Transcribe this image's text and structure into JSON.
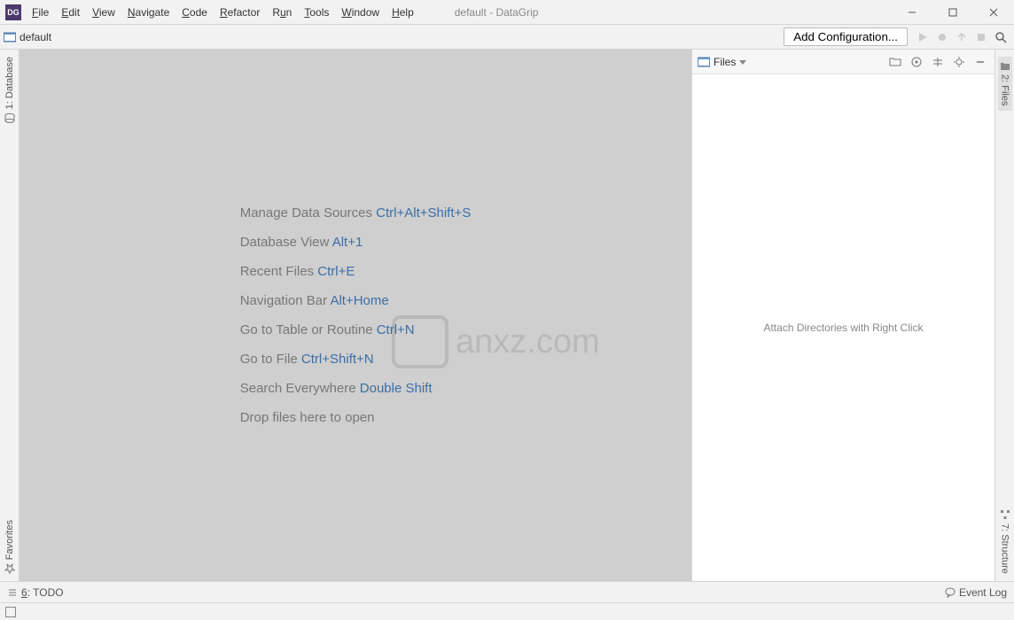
{
  "app": {
    "title": "default - DataGrip",
    "icon_label": "DG"
  },
  "menu": {
    "file": "File",
    "edit": "Edit",
    "view": "View",
    "navigate": "Navigate",
    "code": "Code",
    "refactor": "Refactor",
    "run": "Run",
    "tools": "Tools",
    "window": "Window",
    "help": "Help"
  },
  "toolbar": {
    "project": "default",
    "add_config": "Add Configuration..."
  },
  "left_gutter": {
    "database": "1: Database",
    "favorites": "Favorites"
  },
  "right_gutter": {
    "files": "2: Files",
    "structure": "7: Structure"
  },
  "tips": {
    "manage_ds": {
      "label": "Manage Data Sources ",
      "shortcut": "Ctrl+Alt+Shift+S"
    },
    "db_view": {
      "label": "Database View ",
      "shortcut": "Alt+1"
    },
    "recent": {
      "label": "Recent Files ",
      "shortcut": "Ctrl+E"
    },
    "navbar": {
      "label": "Navigation Bar ",
      "shortcut": "Alt+Home"
    },
    "goto_table": {
      "label": "Go to Table or Routine ",
      "shortcut": "Ctrl+N"
    },
    "goto_file": {
      "label": "Go to File ",
      "shortcut": "Ctrl+Shift+N"
    },
    "search": {
      "label": "Search Everywhere ",
      "shortcut": "Double Shift"
    },
    "drop": {
      "label": "Drop files here to open",
      "shortcut": ""
    }
  },
  "files_panel": {
    "title": "Files",
    "empty": "Attach Directories with Right Click"
  },
  "statusbar": {
    "todo": "6: TODO",
    "event_log": "Event Log"
  },
  "watermark": {
    "text": "anxz.com"
  }
}
